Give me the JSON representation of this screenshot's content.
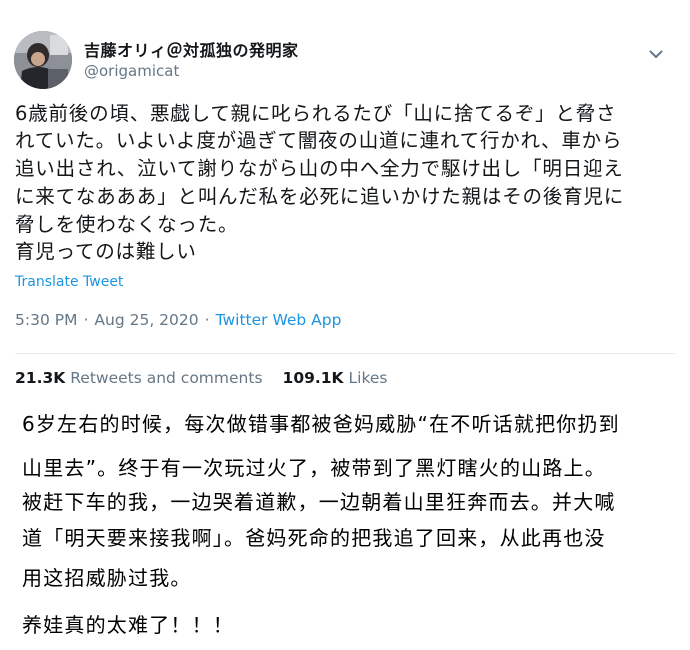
{
  "tweet": {
    "author": {
      "display_name": "吉藤オリィ＠対孤独の発明家",
      "handle": "@origamicat"
    },
    "text_lines": [
      "6歳前後の頃、悪戯して親に叱られるたび「山に捨てるぞ」と脅さ",
      "れていた。いよいよ度が過ぎて闇夜の山道に連れて行かれ、車から",
      "追い出され、泣いて謝りながら山の中へ全力で駆け出し「明日迎え",
      "に来てなあああ」と叫んだ私を必死に追いかけた親はその後育児に",
      "脅しを使わなくなった。",
      "育児ってのは難しい"
    ],
    "translate_label": "Translate Tweet",
    "time": "5:30 PM",
    "date": "Aug 25, 2020",
    "separator": "·",
    "source": "Twitter Web App",
    "retweets_count": "21.3K",
    "retweets_label": "Retweets and comments",
    "likes_count": "109.1K",
    "likes_label": "Likes"
  },
  "translation": {
    "lines": [
      "6岁左右的时候，每次做错事都被爸妈威胁“在不听话就把你扔到",
      "山里去”。终于有一次玩过火了，被带到了黑灯瞎火的山路上。",
      "被赶下车的我，一边哭着道歉，一边朝着山里狂奔而去。并大喊",
      "道「明天要来接我啊」。爸妈死命的把我追了回来，从此再也没",
      "用这招威胁过我。",
      "养娃真的太难了！！！"
    ]
  },
  "colors": {
    "link": "#1b95e0",
    "muted": "#657786",
    "text": "#14171a",
    "divider": "#e6ecf0"
  },
  "icons": {
    "caret": "chevron-down-icon",
    "avatar": "user-avatar-photo"
  }
}
